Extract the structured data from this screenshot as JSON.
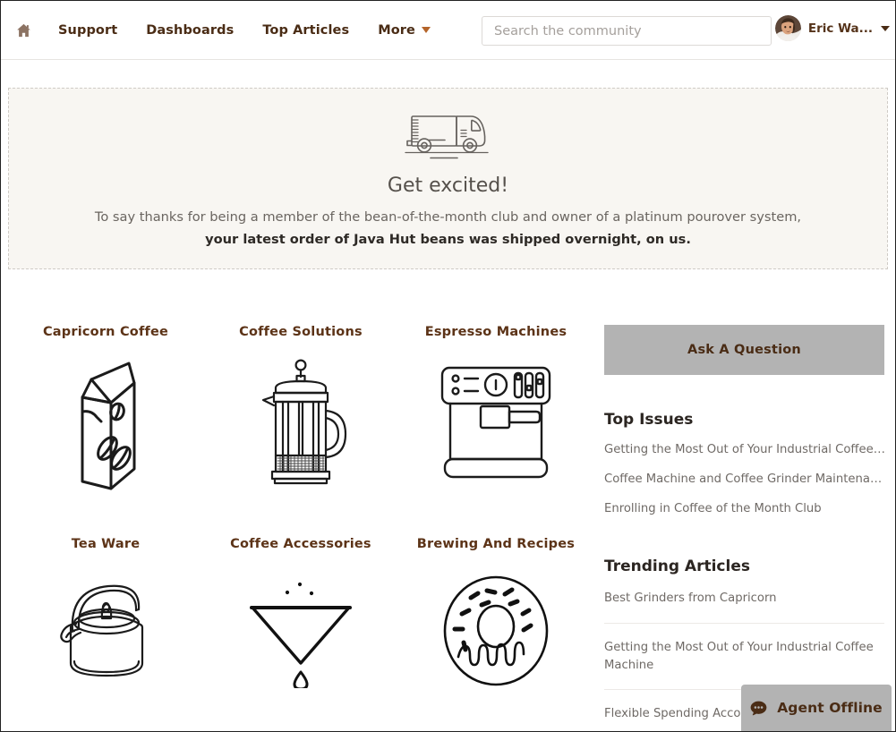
{
  "header": {
    "home_icon": "home-icon",
    "nav": [
      {
        "label": "Support"
      },
      {
        "label": "Dashboards"
      },
      {
        "label": "Top Articles"
      },
      {
        "label": "More"
      }
    ],
    "search": {
      "placeholder": "Search the community",
      "value": ""
    },
    "user": {
      "name": "Eric Wa...",
      "avatar_alt": "user-avatar"
    }
  },
  "banner": {
    "icon": "delivery-truck-icon",
    "title": "Get excited!",
    "line1": "To say thanks for being a member of the bean-of-the-month club and owner of a platinum pourover system,",
    "line2": "your latest order of Java Hut beans was shipped overnight, on us."
  },
  "categories": [
    {
      "title": "Capricorn Coffee",
      "icon": "coffee-bag-icon"
    },
    {
      "title": "Coffee Solutions",
      "icon": "french-press-icon"
    },
    {
      "title": "Espresso Machines",
      "icon": "espresso-machine-icon"
    },
    {
      "title": "Tea Ware",
      "icon": "kettle-icon"
    },
    {
      "title": "Coffee Accessories",
      "icon": "pourover-cone-icon"
    },
    {
      "title": "Brewing And Recipes",
      "icon": "donut-icon"
    }
  ],
  "sidebar": {
    "ask_button": "Ask A Question",
    "top_issues_heading": "Top Issues",
    "top_issues": [
      {
        "label": "Getting the Most Out of Your Industrial Coffee Mach..."
      },
      {
        "label": "Coffee Machine and Coffee Grinder Maintenance"
      },
      {
        "label": "Enrolling in Coffee of the Month Club"
      }
    ],
    "trending_heading": "Trending Articles",
    "trending": [
      {
        "label": "Best Grinders from Capricorn"
      },
      {
        "label": "Getting the Most Out of Your Industrial Coffee Machine"
      },
      {
        "label": "Flexible Spending Account"
      }
    ]
  },
  "chat": {
    "icon": "chat-bubble-icon",
    "label": "Agent Offline"
  },
  "colors": {
    "brand_brown": "#5c3317",
    "accent_orange": "#b4642a",
    "banner_bg": "#f8f6f2",
    "button_grey": "#b3b3b3",
    "muted_text": "#6f6a66"
  }
}
